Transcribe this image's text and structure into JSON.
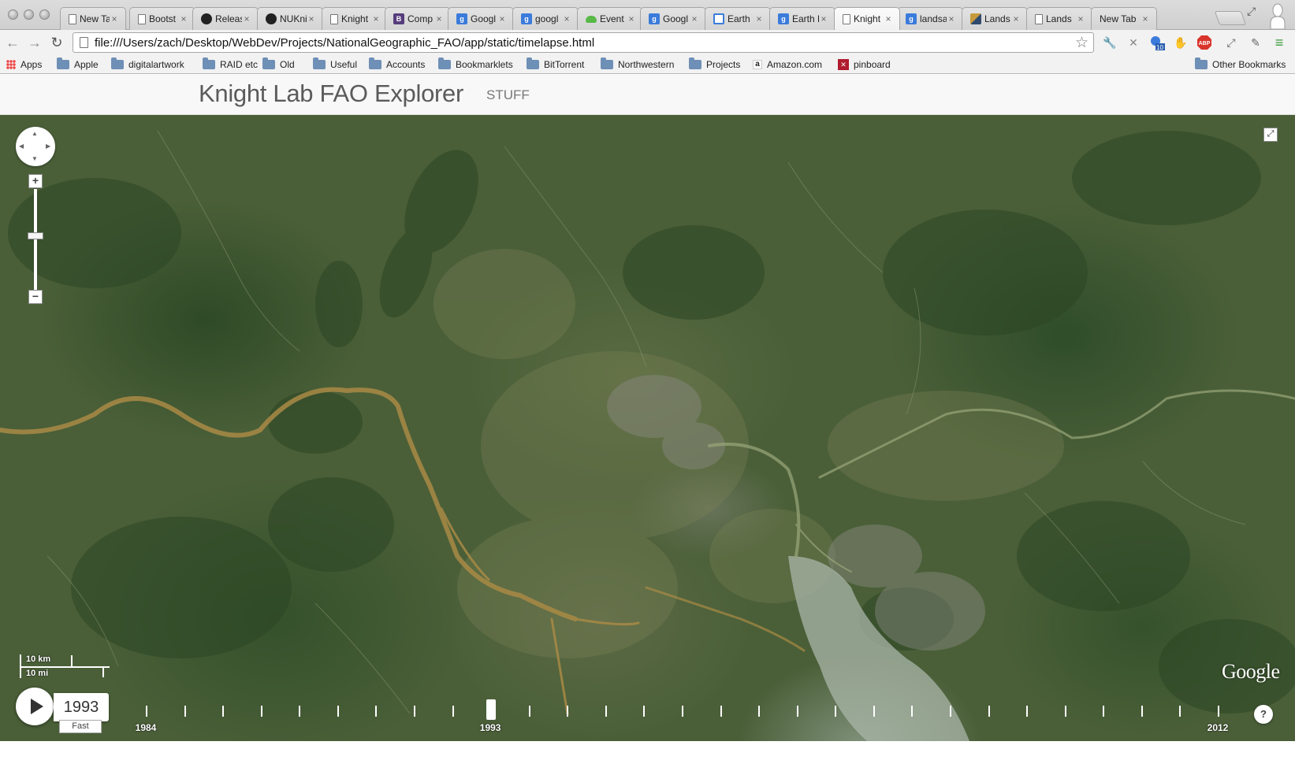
{
  "browser": {
    "tabs": [
      {
        "title": "New Tab",
        "icon": "blank-page-icon",
        "icon_color": "#ffffff"
      },
      {
        "title": "Bootst",
        "icon": "page-icon",
        "icon_color": "#ffffff"
      },
      {
        "title": "Releas",
        "icon": "github-icon",
        "icon_color": "#222222"
      },
      {
        "title": "NUKni",
        "icon": "github-icon",
        "icon_color": "#222222"
      },
      {
        "title": "Knight",
        "icon": "page-icon",
        "icon_color": "#ffffff"
      },
      {
        "title": "Comp",
        "icon": "bootstrap-icon",
        "icon_color": "#563d7c"
      },
      {
        "title": "Googl",
        "icon": "google-icon",
        "icon_color": "#3b7bdb"
      },
      {
        "title": "googl",
        "icon": "google-icon",
        "icon_color": "#3b7bdb"
      },
      {
        "title": "Event",
        "icon": "cloud-icon",
        "icon_color": "#58b947"
      },
      {
        "title": "Googl",
        "icon": "google-icon",
        "icon_color": "#3b7bdb"
      },
      {
        "title": "Earth",
        "icon": "window-icon",
        "icon_color": "#3b7bdb"
      },
      {
        "title": "Earth E",
        "icon": "google-icon",
        "icon_color": "#3b7bdb"
      },
      {
        "title": "Knight",
        "icon": "page-icon",
        "icon_color": "#ffffff",
        "active": true
      },
      {
        "title": "landsa",
        "icon": "google-icon",
        "icon_color": "#3b7bdb"
      },
      {
        "title": "Lands",
        "icon": "landsat-icon",
        "icon_color": "#2f4a6e"
      },
      {
        "title": "Lands",
        "icon": "page-icon",
        "icon_color": "#ffffff"
      },
      {
        "title": "New Tab",
        "icon": "none",
        "icon_color": "#ffffff"
      }
    ],
    "tab_close_glyph": "×",
    "url": "file:///Users/zach/Desktop/WebDev/Projects/NationalGeographic_FAO/app/static/timelapse.html",
    "extension_badge": "10",
    "abp_label": "ABP",
    "bookmarks": [
      {
        "label": "Apps",
        "type": "apps"
      },
      {
        "label": "Apple",
        "type": "folder"
      },
      {
        "label": "digitalartwork",
        "type": "folder"
      },
      {
        "label": "RAID etc",
        "type": "folder"
      },
      {
        "label": "Old",
        "type": "folder"
      },
      {
        "label": "Useful",
        "type": "folder"
      },
      {
        "label": "Accounts",
        "type": "folder"
      },
      {
        "label": "Bookmarklets",
        "type": "folder"
      },
      {
        "label": "BitTorrent",
        "type": "folder"
      },
      {
        "label": "Northwestern",
        "type": "folder"
      },
      {
        "label": "Projects",
        "type": "folder"
      },
      {
        "label": "Amazon.com",
        "type": "amazon"
      },
      {
        "label": "pinboard",
        "type": "pinboard"
      }
    ],
    "other_bookmarks": "Other Bookmarks"
  },
  "page": {
    "brand": "Knight Lab FAO Explorer",
    "nav_link": "STUFF"
  },
  "map": {
    "scale_km": "10 km",
    "scale_mi": "10 mi",
    "attribution": "Google",
    "pan_up": "▲",
    "pan_down": "▼",
    "pan_left": "◀",
    "pan_right": "▶",
    "zoom_in_label": "+",
    "zoom_out_label": "−",
    "zoom_level_fraction": 0.6,
    "fullscreen_glyph": "⤢"
  },
  "timelapse": {
    "current_year": "1993",
    "speed_label": "Fast",
    "help_label": "?",
    "start_year": 1984,
    "end_year": 2012,
    "labeled_years": [
      "1984",
      "1993",
      "2012"
    ],
    "current_year_value": 1993
  },
  "colors": {
    "accent": "#ffffff",
    "header_text": "#5b5b5b",
    "river": "#b08a3e"
  }
}
